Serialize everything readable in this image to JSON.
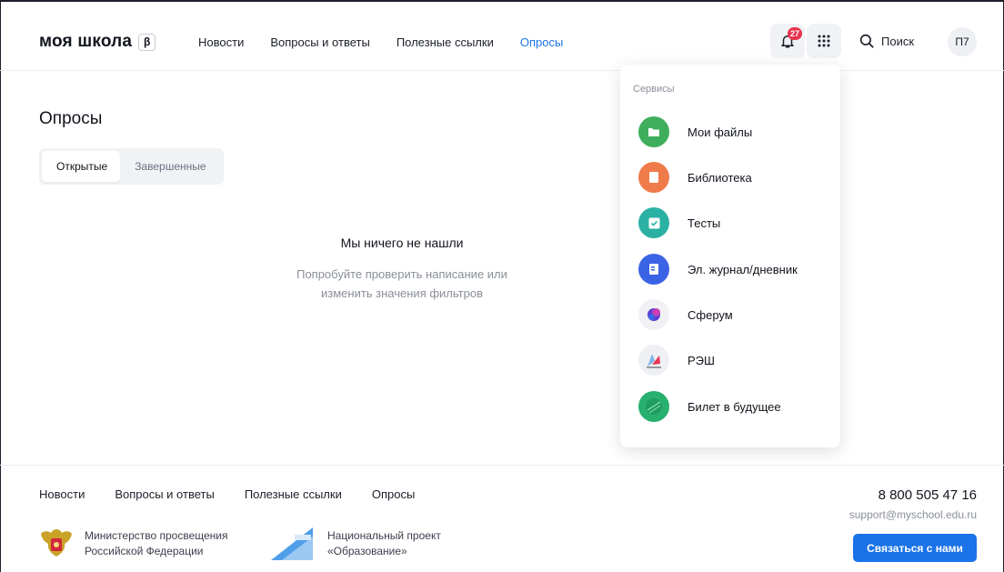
{
  "header": {
    "logo": "моя школа",
    "beta": "β",
    "nav": [
      "Новости",
      "Вопросы и ответы",
      "Полезные ссылки",
      "Опросы"
    ],
    "active_nav": "Опросы",
    "notifications_count": "27",
    "search_label": "Поиск",
    "avatar_initials": "П7"
  },
  "main": {
    "title": "Опросы",
    "tabs": [
      {
        "label": "Открытые",
        "active": true
      },
      {
        "label": "Завершенные",
        "active": false
      }
    ],
    "empty_title": "Мы ничего не нашли",
    "empty_line1": "Попробуйте проверить написание или",
    "empty_line2": "изменить значения фильтров"
  },
  "services": {
    "title": "Сервисы",
    "items": [
      {
        "label": "Мои файлы",
        "icon": "folder-icon",
        "color": "#3fae5c"
      },
      {
        "label": "Библиотека",
        "icon": "book-icon",
        "color": "#f07b4a"
      },
      {
        "label": "Тесты",
        "icon": "checkbox-icon",
        "color": "#2bb1a4"
      },
      {
        "label": "Эл. журнал/дневник",
        "icon": "journal-icon",
        "color": "#3b63e6"
      },
      {
        "label": "Сферум",
        "icon": "sferum-icon",
        "color": "#f1f1f5"
      },
      {
        "label": "РЭШ",
        "icon": "resh-icon",
        "color": "#eef0f4"
      },
      {
        "label": "Билет в будущее",
        "icon": "ticket-icon",
        "color": "#27b06e"
      }
    ]
  },
  "footer": {
    "nav": [
      "Новости",
      "Вопросы и ответы",
      "Полезные ссылки",
      "Опросы"
    ],
    "phone": "8 800 505 47 16",
    "email": "support@myschool.edu.ru",
    "contact_button": "Связаться с нами",
    "ministry_line1": "Министерство просвещения",
    "ministry_line2": "Российской Федерации",
    "project_line1": "Национальный проект",
    "project_line2": "«Образование»"
  },
  "colors": {
    "accent": "#1a73e8",
    "badge": "#e8344e"
  }
}
